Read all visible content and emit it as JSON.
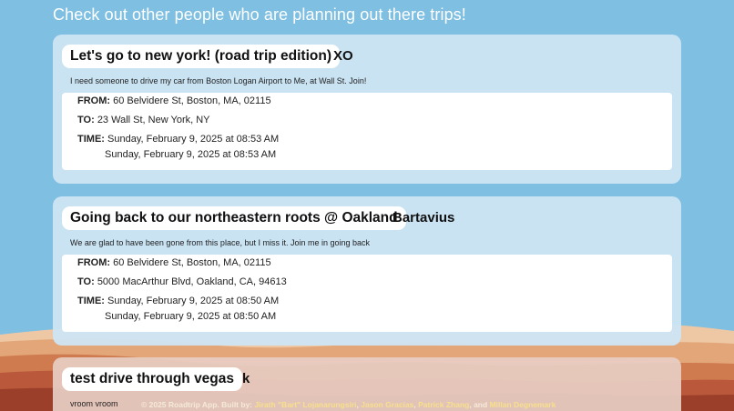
{
  "page": {
    "heading": "Check out other people who are planning out there trips!"
  },
  "trips": [
    {
      "title": "Let's go to new york! (road trip edition)",
      "author": "XO",
      "description": "I need someone to drive my car from Boston Logan Airport to Me, at Wall St. Join!",
      "from_label": "FROM:",
      "from": "60 Belvidere St, Boston, MA, 02115",
      "to_label": "TO:",
      "to": "23 Wall St, New York, NY",
      "time_label": "TIME:",
      "time_start": "Sunday, February 9, 2025 at 08:53 AM",
      "time_end": "Sunday, February 9, 2025 at 08:53 AM"
    },
    {
      "title": "Going back to our northeastern roots @ Oakland",
      "author": "Bartavius",
      "description": "We are glad to have been gone from this place, but I miss it. Join me in going back",
      "from_label": "FROM:",
      "from": "60 Belvidere St, Boston, MA, 02115",
      "to_label": "TO:",
      "to": "5000 MacArthur Blvd, Oakland, CA, 94613",
      "time_label": "TIME:",
      "time_start": "Sunday, February 9, 2025 at 08:50 AM",
      "time_end": "Sunday, February 9, 2025 at 08:50 AM"
    },
    {
      "title": "test drive through vegas",
      "author": "k",
      "description": "vroom vroom"
    }
  ],
  "footer": {
    "prefix": "© 2025 Roadtrip App. Built by:",
    "authors": [
      "Jirath \"Bart\" Lojanarungsiri",
      "Jason Gracias",
      "Patrick Zhang",
      "Millan Degnemark"
    ],
    "sep1": ",",
    "sep2": ",",
    "sep3": ", and"
  },
  "colors": {
    "sky": "#7ebfe2",
    "card": "#cde5f3",
    "footer_text": "#f5ead8",
    "footer_names": "#f7e08c"
  }
}
